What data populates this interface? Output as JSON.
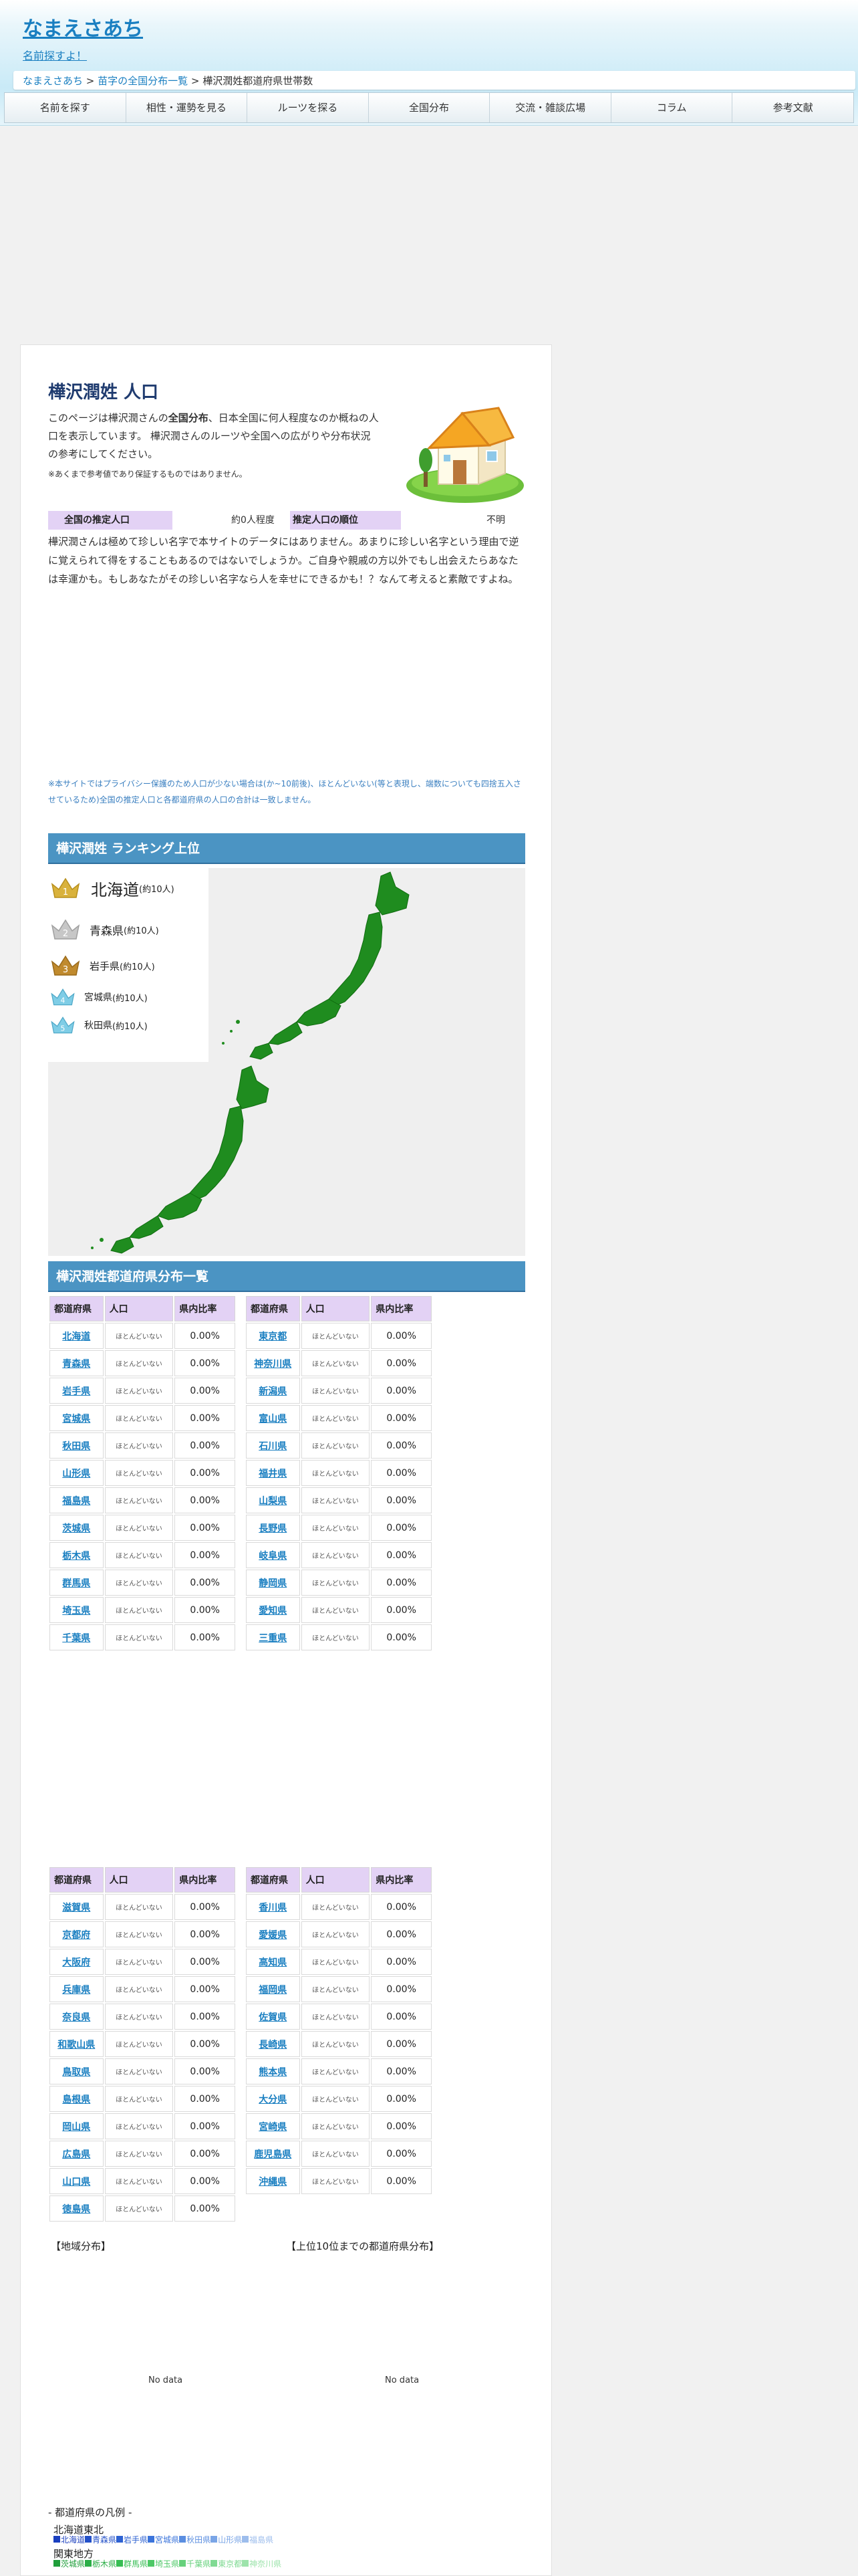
{
  "header": {
    "site_title": "なまえさあち",
    "tagline": "名前探すよ！",
    "breadcrumb": {
      "home": "なまえさあち",
      "sep1": " > ",
      "list": "苗字の全国分布一覧",
      "sep2": " > ",
      "current": "樺沢潤姓都道府県世帯数"
    }
  },
  "nav": [
    "名前を探す",
    "相性・運勢を見る",
    "ルーツを探る",
    "全国分布",
    "交流・雑談広場",
    "コラム",
    "参考文献"
  ],
  "main": {
    "title": "樺沢潤姓 人口",
    "intro_line1_pre": "このページは樺沢潤さんの",
    "intro_line1_bold": "全国分布",
    "intro_line1_post": "、日本全国に何人程度なのか概ねの人",
    "intro_line2": "口を表示しています。 樺沢潤さんのルーツや全国への広がりや分布状況",
    "intro_line3": "の参考にしてください。",
    "intro_note": "※あくまで参考値であり保証するものではありません。",
    "stats": {
      "population_label": "全国の推定人口",
      "population_value": "約0人程度",
      "rank_label": "推定人口の順位",
      "rank_value": "不明"
    },
    "body_text": "樺沢潤さんは極めて珍しい名字で本サイトのデータにはありません。あまりに珍しい名字という理由で逆に覚えられて得をすることもあるのではないでしょうか。ご自身や親戚の方以外でもし出会えたらあなたは幸運かも。もしあなたがその珍しい名字なら人を幸せにできるかも！？なんて考えると素敵ですよね。",
    "privacy_note": "※本サイトではプライバシー保護のため人口が少ない場合は(か~10前後)、ほとんどいない(等と表現し、端数についても四捨五入させているため)全国の推定人口と各都道府県の人口の合計は一致しません。"
  },
  "ranking": {
    "heading": "樺沢潤姓 ランキング上位",
    "items": [
      {
        "rank": "1",
        "pref": "北海道",
        "count": "(約10人)",
        "color": "#d9b23c"
      },
      {
        "rank": "2",
        "pref": "青森県",
        "count": "(約10人)",
        "color": "#c7c7c7"
      },
      {
        "rank": "3",
        "pref": "岩手県",
        "count": "(約10人)",
        "color": "#c08a2e"
      },
      {
        "rank": "4",
        "pref": "宮城県",
        "count": "(約10人)",
        "color": "#7fcde6"
      },
      {
        "rank": "5",
        "pref": "秋田県",
        "count": "(約10人)",
        "color": "#7fcde6"
      }
    ]
  },
  "distribution": {
    "heading": "樺沢潤姓都道府県分布一覧",
    "headers": [
      "都道府県",
      "人口",
      "県内比率"
    ],
    "pop_text": "ほとんどいない",
    "ratio_text": "0.00%",
    "table1": [
      "北海道",
      "青森県",
      "岩手県",
      "宮城県",
      "秋田県",
      "山形県",
      "福島県",
      "茨城県",
      "栃木県",
      "群馬県",
      "埼玉県",
      "千葉県"
    ],
    "table2": [
      "東京都",
      "神奈川県",
      "新潟県",
      "富山県",
      "石川県",
      "福井県",
      "山梨県",
      "長野県",
      "岐阜県",
      "静岡県",
      "愛知県",
      "三重県"
    ],
    "table3": [
      "滋賀県",
      "京都府",
      "大阪府",
      "兵庫県",
      "奈良県",
      "和歌山県",
      "鳥取県",
      "島根県",
      "岡山県",
      "広島県",
      "山口県",
      "徳島県"
    ],
    "table4": [
      "香川県",
      "愛媛県",
      "高知県",
      "福岡県",
      "佐賀県",
      "長崎県",
      "熊本県",
      "大分県",
      "宮崎県",
      "鹿児島県",
      "沖縄県"
    ]
  },
  "charts": {
    "region_label": "【地域分布】",
    "top10_label": "【上位10位までの都道府県分布】",
    "nodata": "No data"
  },
  "legend": {
    "title": "- 都道府県の凡例 -",
    "hokkaido_tohoku": "北海道東北",
    "hokkaido_tohoku_prefs": [
      {
        "name": "北海道",
        "color": "#1a3fbf"
      },
      {
        "name": "青森県",
        "color": "#2350c8"
      },
      {
        "name": "岩手県",
        "color": "#2e62d2"
      },
      {
        "name": "宮城県",
        "color": "#3b74db"
      },
      {
        "name": "秋田県",
        "color": "#5b8ee0"
      },
      {
        "name": "山形県",
        "color": "#7aa5e6"
      },
      {
        "name": "福島県",
        "color": "#9dbdec"
      }
    ],
    "kanto": "関東地方",
    "kanto_prefs": [
      {
        "name": "茨城県",
        "color": "#1f9e3a"
      },
      {
        "name": "栃木県",
        "color": "#2aae46"
      },
      {
        "name": "群馬県",
        "color": "#37bd53"
      },
      {
        "name": "埼玉県",
        "color": "#4dc866"
      },
      {
        "name": "千葉県",
        "color": "#66d17c"
      },
      {
        "name": "東京都",
        "color": "#80da93"
      },
      {
        "name": "神奈川県",
        "color": "#9de3ab"
      }
    ]
  }
}
